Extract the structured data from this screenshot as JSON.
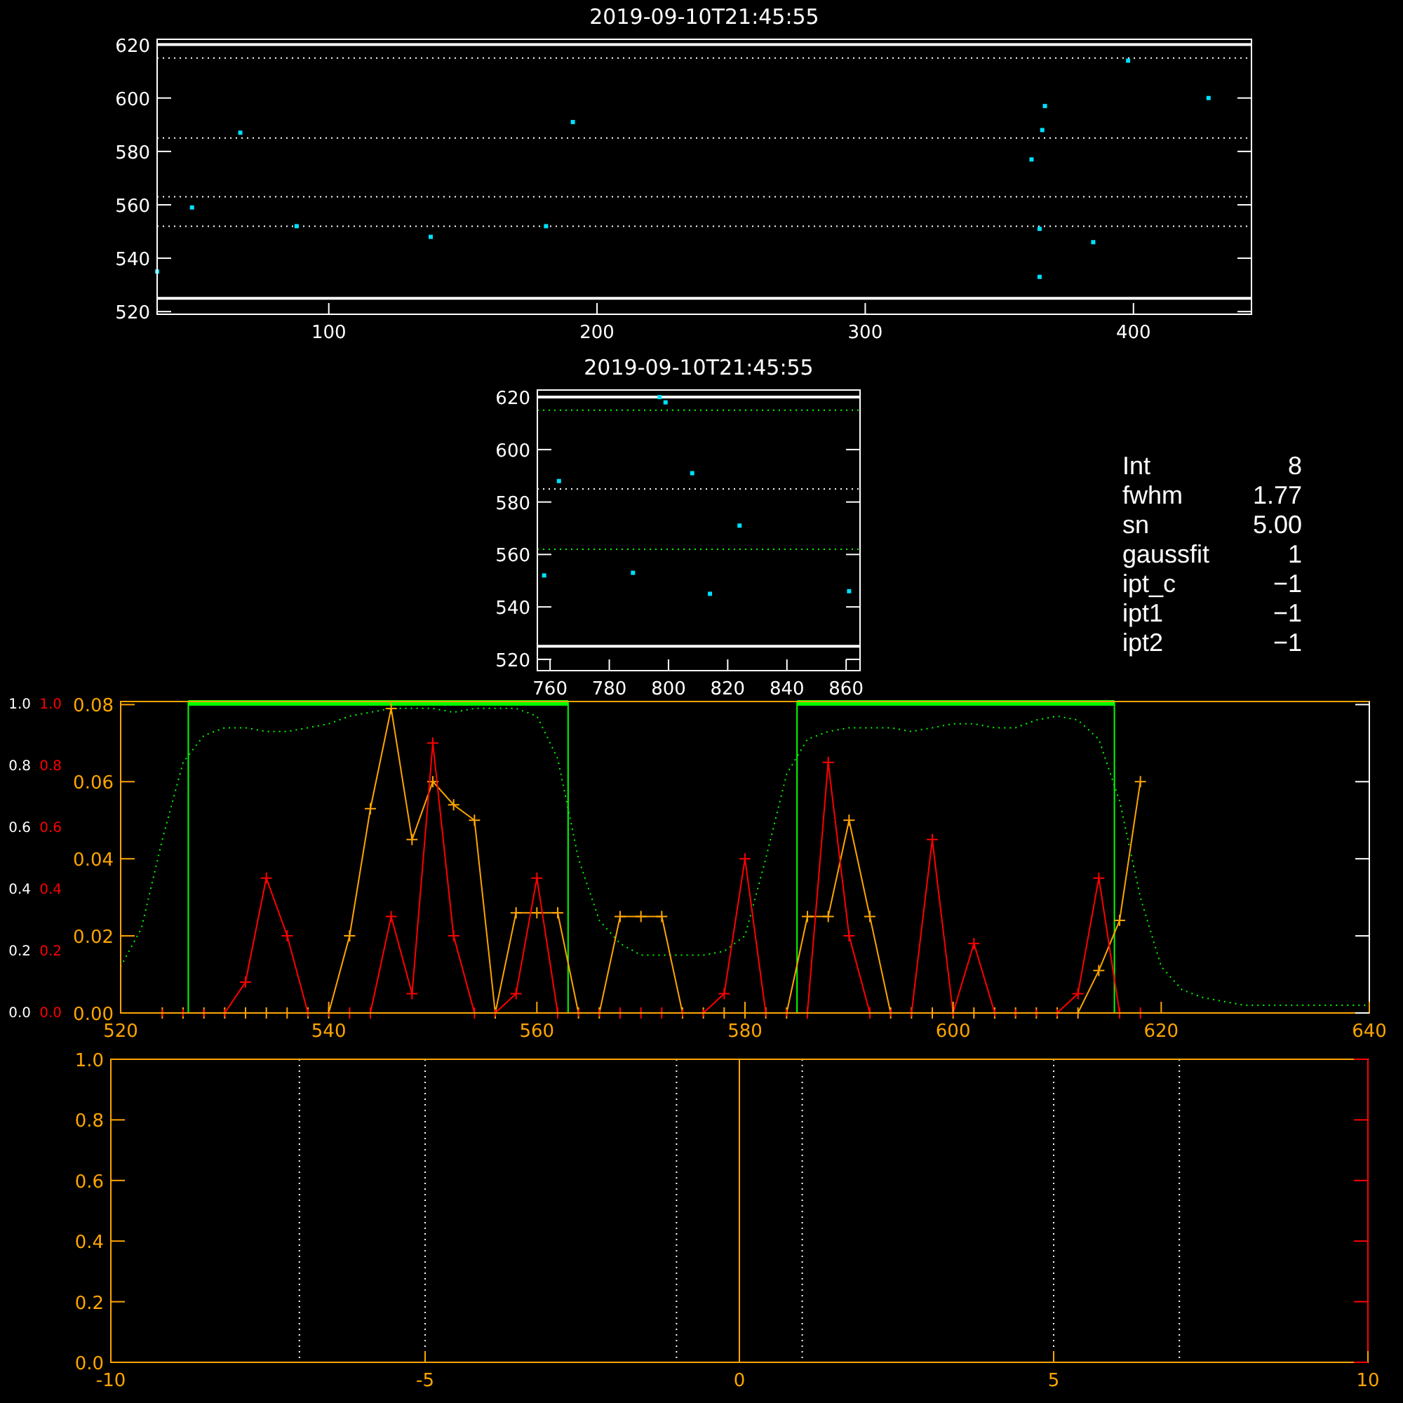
{
  "panels": [
    {
      "title": "2019-09-10T21:45:55",
      "chart_data": {
        "type": "scatter",
        "x": [
          36,
          49,
          67,
          88,
          138,
          181,
          191,
          362,
          365,
          365,
          366,
          367,
          385,
          398,
          428
        ],
        "series": [
          {
            "color": "#00e0ff",
            "values": [
              535,
              559,
              587,
              552,
              548,
              552,
              591,
              577,
              551,
              533,
              588,
              597,
              546,
              614,
              600
            ]
          }
        ],
        "xlim": [
          36,
          444
        ],
        "ylim": [
          519,
          622
        ],
        "xticks": [
          100,
          200,
          300,
          400
        ],
        "yticks": [
          520,
          540,
          560,
          580,
          600,
          620
        ],
        "ref_lines": [
          {
            "axis": "y",
            "value": 620,
            "line_style": "solid",
            "color": "#ffffff"
          },
          {
            "axis": "y",
            "value": 615,
            "line_style": "dotted",
            "color": "#ffffff"
          },
          {
            "axis": "y",
            "value": 585,
            "line_style": "dotted",
            "color": "#ffffff"
          },
          {
            "axis": "y",
            "value": 563,
            "line_style": "dotted",
            "color": "#ffffff"
          },
          {
            "axis": "y",
            "value": 552,
            "line_style": "dotted",
            "color": "#ffffff"
          },
          {
            "axis": "y",
            "value": 525,
            "line_style": "solid",
            "color": "#ffffff"
          }
        ]
      }
    },
    {
      "title": "2019-09-10T21:45:55",
      "chart_data": {
        "type": "scatter",
        "x": [
          758,
          763,
          788,
          797,
          799,
          808,
          814,
          824,
          861
        ],
        "series": [
          {
            "color": "#00e0ff",
            "values": [
              552,
              588,
              553,
              620,
              618,
              591,
              545,
              571,
              546
            ]
          }
        ],
        "xlim": [
          755.7,
          864.7
        ],
        "ylim": [
          515.7,
          622.7
        ],
        "xticks": [
          760,
          780,
          800,
          820,
          840,
          860
        ],
        "yticks": [
          520,
          540,
          560,
          580,
          600,
          620
        ],
        "ref_lines": [
          {
            "axis": "y",
            "value": 620,
            "line_style": "solid",
            "color": "#ffffff"
          },
          {
            "axis": "y",
            "value": 615,
            "line_style": "dotted",
            "color": "#00ff00"
          },
          {
            "axis": "y",
            "value": 585,
            "line_style": "dotted",
            "color": "#ffffff"
          },
          {
            "axis": "y",
            "value": 562,
            "line_style": "dotted",
            "color": "#00ff00"
          },
          {
            "axis": "y",
            "value": 525,
            "line_style": "solid",
            "color": "#ffffff"
          }
        ]
      },
      "fit_info": [
        {
          "key": "Int",
          "value": "8"
        },
        {
          "key": "fwhm",
          "value": "1.77"
        },
        {
          "key": "sn",
          "value": "5.00"
        },
        {
          "key": "gaussfit",
          "value": "1"
        },
        {
          "key": "ipt_c",
          "value": "−1"
        },
        {
          "key": "ipt1",
          "value": "−1"
        },
        {
          "key": "ipt2",
          "value": "−1"
        }
      ]
    },
    {
      "extra_y_labels": [
        {
          "color": "#ffffff",
          "labels": [
            "1.0",
            "0.8",
            "0.6",
            "0.4",
            "0.2",
            "0.0"
          ]
        },
        {
          "color": "#ff0000",
          "labels": [
            "1.0",
            "0.8",
            "0.6",
            "0.4",
            "0.2",
            "0.0"
          ]
        }
      ],
      "chart_data": {
        "type": "line",
        "x": [
          520,
          522,
          524,
          526,
          528,
          530,
          532,
          534,
          536,
          538,
          540,
          542,
          544,
          546,
          548,
          550,
          552,
          554,
          556,
          558,
          560,
          562,
          564,
          566,
          568,
          570,
          572,
          574,
          576,
          578,
          580,
          582,
          584,
          586,
          588,
          590,
          592,
          594,
          596,
          598,
          600,
          602,
          604,
          606,
          608,
          610,
          612,
          614,
          616,
          618,
          620,
          622,
          624,
          626,
          628,
          630,
          632,
          634,
          636,
          638,
          640
        ],
        "series": [
          {
            "color": "#00ff00",
            "line_style": "dotted",
            "values": [
              0.012,
              0.022,
              0.045,
              0.065,
              0.072,
              0.074,
              0.074,
              0.073,
              0.073,
              0.074,
              0.075,
              0.077,
              0.078,
              0.079,
              0.079,
              0.079,
              0.078,
              0.079,
              0.079,
              0.079,
              0.077,
              0.066,
              0.04,
              0.024,
              0.018,
              0.015,
              0.015,
              0.015,
              0.015,
              0.016,
              0.02,
              0.04,
              0.062,
              0.071,
              0.073,
              0.074,
              0.074,
              0.074,
              0.073,
              0.074,
              0.075,
              0.075,
              0.074,
              0.074,
              0.076,
              0.077,
              0.076,
              0.071,
              0.055,
              0.03,
              0.012,
              0.006,
              0.004,
              0.003,
              0.002,
              0.002,
              0.002,
              0.002,
              0.002,
              0.002,
              0.002
            ]
          },
          {
            "color": "#ffa500",
            "marker": "+",
            "values": [
              null,
              null,
              0,
              0,
              0,
              0,
              0,
              0,
              0,
              0,
              0,
              0.02,
              0.053,
              0.079,
              0.045,
              0.06,
              0.054,
              0.05,
              0,
              0.026,
              0.026,
              0.026,
              0,
              0,
              0.025,
              0.025,
              0.025,
              0,
              0,
              0,
              0,
              0,
              0,
              0.025,
              0.025,
              0.05,
              0.025,
              0,
              0,
              0,
              0,
              0,
              0,
              0,
              0,
              0,
              0,
              0.011,
              0.024,
              0.06,
              null,
              null,
              null,
              null,
              null,
              null,
              null,
              null,
              null,
              null,
              null
            ]
          },
          {
            "color": "#ff0000",
            "marker": "+",
            "values": [
              null,
              null,
              0,
              0,
              0,
              0,
              0.008,
              0.035,
              0.02,
              0,
              0,
              0,
              0,
              0.025,
              0.005,
              0.07,
              0.02,
              0,
              0,
              0.005,
              0.035,
              0,
              0,
              0,
              0,
              0,
              0,
              0,
              0,
              0.005,
              0.04,
              0,
              0,
              0,
              0.065,
              0.02,
              0,
              0,
              0,
              0.045,
              0,
              0.018,
              0,
              0,
              0,
              0,
              0.005,
              0.035,
              0,
              0,
              null,
              null,
              null,
              null,
              null,
              null,
              null,
              null,
              null,
              null,
              null
            ]
          }
        ],
        "xlim": [
          520,
          640
        ],
        "ylim": [
          0,
          0.0808
        ],
        "xticks": [
          520,
          540,
          560,
          580,
          600,
          620,
          640
        ],
        "yticks": [
          {
            "value": 0,
            "label": "0.00"
          },
          {
            "value": 0.02,
            "label": "0.02"
          },
          {
            "value": 0.04,
            "label": "0.04"
          },
          {
            "value": 0.06,
            "label": "0.06"
          },
          {
            "value": 0.08,
            "label": "0.08"
          }
        ],
        "ref_lines": [
          {
            "axis": "x",
            "value": 526.5,
            "line_style": "solid",
            "color": "#00ff00"
          },
          {
            "axis": "x",
            "value": 563,
            "line_style": "solid",
            "color": "#00ff00"
          },
          {
            "axis": "x",
            "value": 585,
            "line_style": "solid",
            "color": "#00ff00"
          },
          {
            "axis": "x",
            "value": 615.5,
            "line_style": "solid",
            "color": "#00ff00"
          }
        ]
      }
    },
    {
      "chart_data": {
        "type": "line",
        "xlim": [
          -10,
          10
        ],
        "ylim": [
          0,
          1
        ],
        "xticks": [
          -10,
          -5,
          0,
          5,
          10
        ],
        "yticks": [
          {
            "value": 0,
            "label": "0.0"
          },
          {
            "value": 0.2,
            "label": "0.2"
          },
          {
            "value": 0.4,
            "label": "0.4"
          },
          {
            "value": 0.6,
            "label": "0.6"
          },
          {
            "value": 0.8,
            "label": "0.8"
          },
          {
            "value": 1,
            "label": "1.0"
          }
        ],
        "ref_lines": [
          {
            "axis": "x",
            "value": -7,
            "line_style": "dotted",
            "color": "#ffffff"
          },
          {
            "axis": "x",
            "value": -5,
            "line_style": "dotted",
            "color": "#ffffff"
          },
          {
            "axis": "x",
            "value": -1,
            "line_style": "dotted",
            "color": "#ffffff"
          },
          {
            "axis": "x",
            "value": 0,
            "line_style": "solid",
            "color": "#ffa500"
          },
          {
            "axis": "x",
            "value": 1,
            "line_style": "dotted",
            "color": "#ffffff"
          },
          {
            "axis": "x",
            "value": 5,
            "line_style": "dotted",
            "color": "#ffffff"
          },
          {
            "axis": "x",
            "value": 7,
            "line_style": "dotted",
            "color": "#ffffff"
          }
        ]
      }
    }
  ]
}
